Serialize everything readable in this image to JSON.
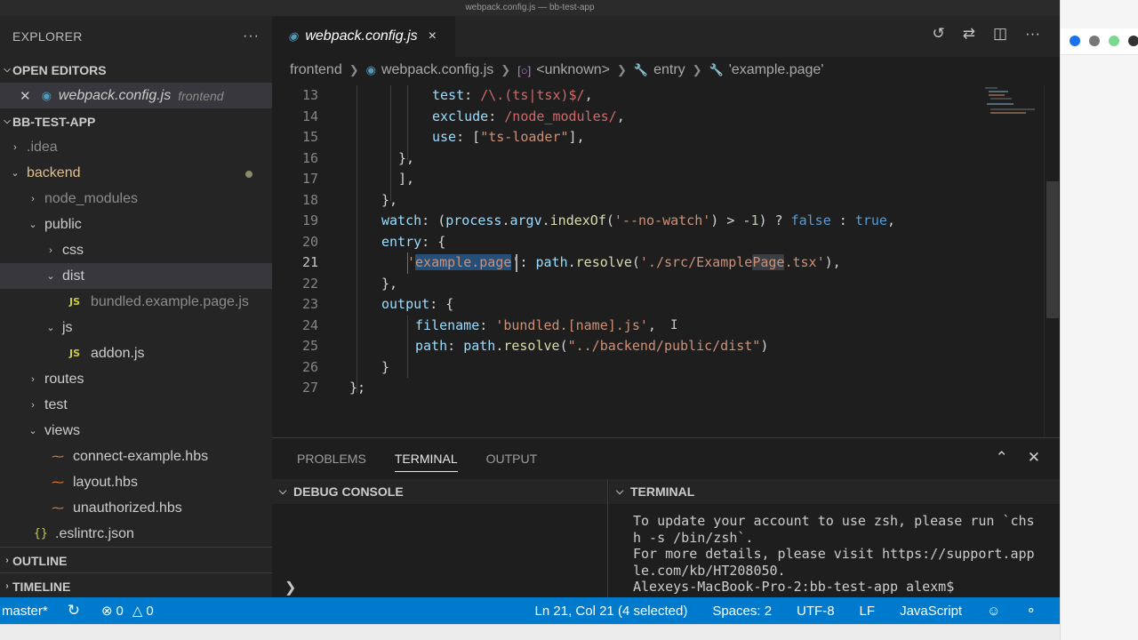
{
  "window": {
    "title": "webpack.config.js — bb-test-app"
  },
  "sidebar": {
    "header": "EXPLORER",
    "more": "···",
    "open_editors_label": "OPEN EDITORS",
    "open_editor": {
      "name": "webpack.config.js",
      "folder": "frontend"
    },
    "project_label": "BB-TEST-APP",
    "tree": [
      {
        "label": ".idea",
        "chev": "›",
        "indent": 0,
        "dim": true
      },
      {
        "label": "backend",
        "chev": "⌄",
        "indent": 0,
        "modified": true,
        "color": "#e2c08d"
      },
      {
        "label": "node_modules",
        "chev": "›",
        "indent": 1,
        "dim": true
      },
      {
        "label": "public",
        "chev": "⌄",
        "indent": 1
      },
      {
        "label": "css",
        "chev": "›",
        "indent": 2
      },
      {
        "label": "dist",
        "chev": "⌄",
        "indent": 2,
        "selected": true
      },
      {
        "label": "bundled.example.page.js",
        "icon": "JS",
        "indent": 3,
        "dim": true
      },
      {
        "label": "js",
        "chev": "⌄",
        "indent": 2
      },
      {
        "label": "addon.js",
        "icon": "JS",
        "indent": 3
      },
      {
        "label": "routes",
        "chev": "›",
        "indent": 1
      },
      {
        "label": "test",
        "chev": "›",
        "indent": 1
      },
      {
        "label": "views",
        "chev": "⌄",
        "indent": 1
      },
      {
        "label": "connect-example.hbs",
        "icon": "hbs",
        "indent": 2
      },
      {
        "label": "layout.hbs",
        "icon": "hbs",
        "indent": 2
      },
      {
        "label": "unauthorized.hbs",
        "icon": "hbs",
        "indent": 2
      },
      {
        "label": ".eslintrc.json",
        "icon": "{}",
        "indent": 1
      }
    ],
    "outline_label": "OUTLINE",
    "timeline_label": "TIMELINE"
  },
  "editor": {
    "tab": {
      "name": "webpack.config.js",
      "close": "×"
    },
    "breadcrumb": [
      "frontend",
      "webpack.config.js",
      "<unknown>",
      "entry",
      "'example.page'"
    ],
    "lines": [
      13,
      14,
      15,
      16,
      17,
      18,
      19,
      20,
      21,
      22,
      23,
      24,
      25,
      26,
      27
    ],
    "current_line": 21
  },
  "panel": {
    "tabs": [
      "PROBLEMS",
      "TERMINAL",
      "OUTPUT"
    ],
    "active_tab": "TERMINAL",
    "debug_label": "DEBUG CONSOLE",
    "terminal_label": "TERMINAL",
    "terminal_text": "To update your account to use zsh, please run `chs\nh -s /bin/zsh`.\nFor more details, please visit https://support.app\nle.com/kb/HT208050.\nAlexeys-MacBook-Pro-2:bb-test-app alexm$"
  },
  "status": {
    "branch": "master*",
    "errors": "0",
    "warnings": "0",
    "position": "Ln 21, Col 21 (4 selected)",
    "spaces": "Spaces: 2",
    "encoding": "UTF-8",
    "eol": "LF",
    "language": "JavaScript"
  },
  "colors": {
    "accent": "#007acc",
    "editor_bg": "#1e1e1e",
    "sidebar_bg": "#252526"
  },
  "icons": [
    "more-icon",
    "close-icon",
    "js-file-icon",
    "hbs-file-icon",
    "json-file-icon",
    "chevron-icon",
    "history-icon",
    "compare-icon",
    "split-editor-icon",
    "sync-icon",
    "error-icon",
    "warning-icon",
    "feedback-icon",
    "bell-icon"
  ]
}
